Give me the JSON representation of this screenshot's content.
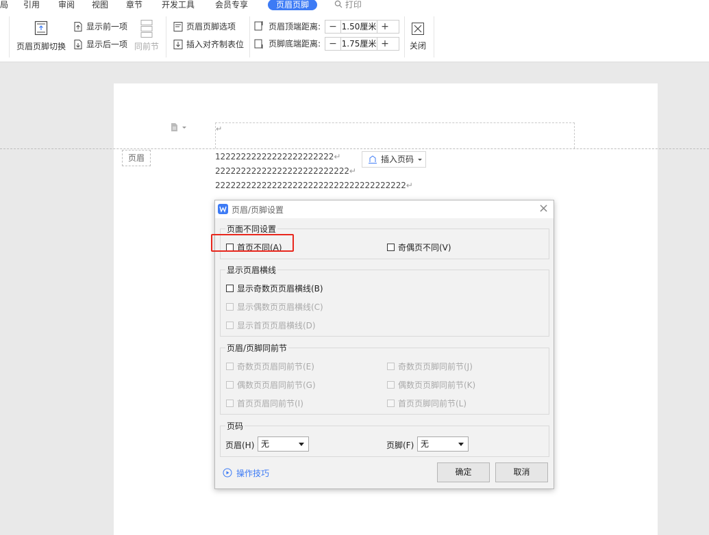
{
  "tabs": {
    "t0": "局",
    "t1": "引用",
    "t2": "审阅",
    "t3": "视图",
    "t4": "章节",
    "t5": "开发工具",
    "t6": "会员专享",
    "t7": "页眉页脚",
    "search": "打印"
  },
  "ribbon": {
    "switch_label": "页眉页脚切换",
    "prev_label": "显示前一项",
    "next_label": "显示后一项",
    "same_prev_label": "同前节",
    "options_label": "页眉页脚选项",
    "tab_align_label": "插入对齐制表位",
    "top_dist_label": "页眉顶端距离:",
    "top_dist_value": "1.50厘米",
    "bottom_dist_label": "页脚底端距离:",
    "bottom_dist_value": "1.75厘米",
    "minus": "−",
    "plus": "+",
    "close_label": "关闭"
  },
  "document": {
    "header_tag": "页眉",
    "line1": "12222222222222222222222",
    "line2": "22222222222222222222222222",
    "line3": "2222222222222222222222222222222222222",
    "return_mark": "↵",
    "insert_page_number": "插入页码"
  },
  "dialog": {
    "title": "页眉/页脚设置",
    "close": "×",
    "group1_label": "页面不同设置",
    "first_page_diff": "首页不同(A)",
    "odd_even_diff": "奇偶页不同(V)",
    "group2_label": "显示页眉横线",
    "show_odd_line": "显示奇数页页眉横线(B)",
    "show_even_line": "显示偶数页页眉横线(C)",
    "show_first_line": "显示首页页眉横线(D)",
    "group3_label": "页眉/页脚同前节",
    "odd_header_same": "奇数页页眉同前节(E)",
    "even_header_same": "偶数页页眉同前节(G)",
    "first_header_same": "首页页眉同前节(I)",
    "odd_footer_same": "奇数页页脚同前节(J)",
    "even_footer_same": "偶数页页脚同前节(K)",
    "first_footer_same": "首页页脚同前节(L)",
    "group4_label": "页码",
    "header_label": "页眉(H)",
    "header_value": "无",
    "footer_label": "页脚(F)",
    "footer_value": "无",
    "tips": "操作技巧",
    "ok": "确定",
    "cancel": "取消"
  },
  "colors": {
    "accent": "#3d7bf5",
    "highlight": "#e8261c"
  }
}
